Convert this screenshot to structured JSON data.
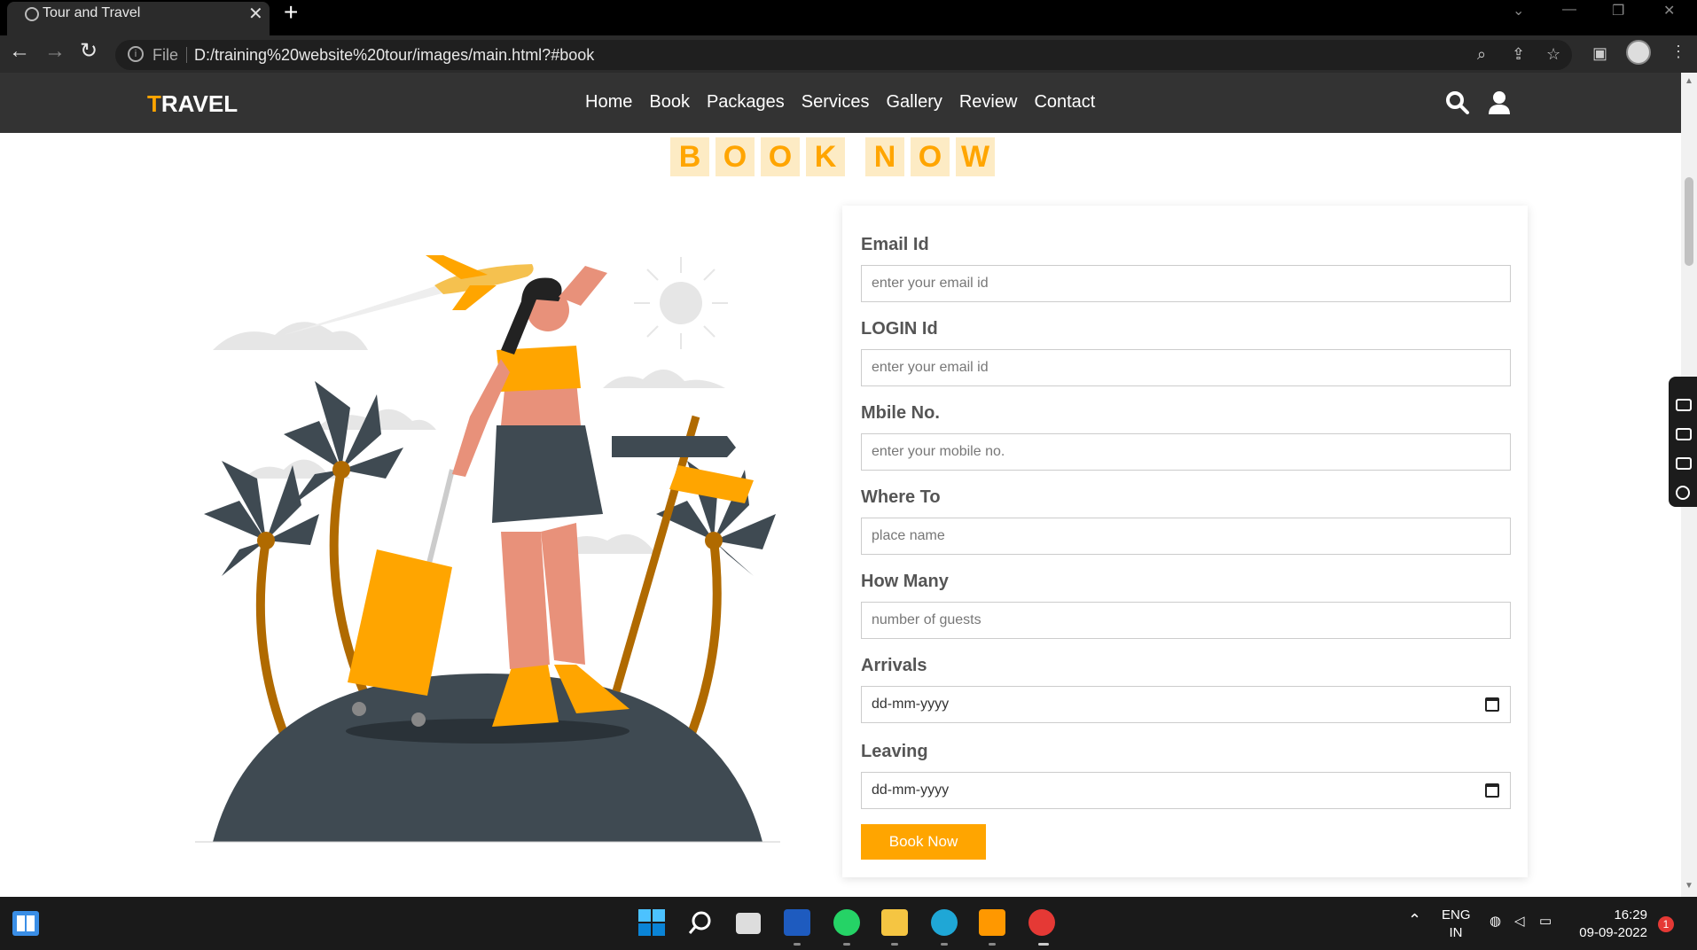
{
  "browser": {
    "tab_title": "Tour and Travel",
    "close_glyph": "✕",
    "newtab_glyph": "+",
    "scheme_label": "File",
    "url": "D:/training%20website%20tour/images/main.html?#book"
  },
  "site": {
    "logo_first": "T",
    "logo_rest": "RAVEL",
    "nav": [
      "Home",
      "Book",
      "Packages",
      "Services",
      "Gallery",
      "Review",
      "Contact"
    ]
  },
  "book_title": [
    "B",
    "O",
    "O",
    "K",
    "N",
    "O",
    "W"
  ],
  "form": {
    "email_label": "Email Id",
    "email_placeholder": "enter your email id",
    "login_label": "LOGIN Id",
    "login_placeholder": "enter your email id",
    "mobile_label": "Mbile No.",
    "mobile_placeholder": "enter your mobile no.",
    "where_label": "Where To",
    "where_placeholder": "place name",
    "howmany_label": "How Many",
    "howmany_placeholder": "number of guests",
    "arrivals_label": "Arrivals",
    "arrivals_value": "dd-mm-yyyy",
    "leaving_label": "Leaving",
    "leaving_value": "dd-mm-yyyy",
    "submit_label": "Book Now"
  },
  "taskbar": {
    "lang_line1": "ENG",
    "lang_line2": "IN",
    "time": "16:29",
    "date": "09-09-2022",
    "notification_count": "1"
  },
  "colors": {
    "accent": "#ffa500",
    "header_bg": "#333333",
    "title_bg": "#fdebc4"
  }
}
